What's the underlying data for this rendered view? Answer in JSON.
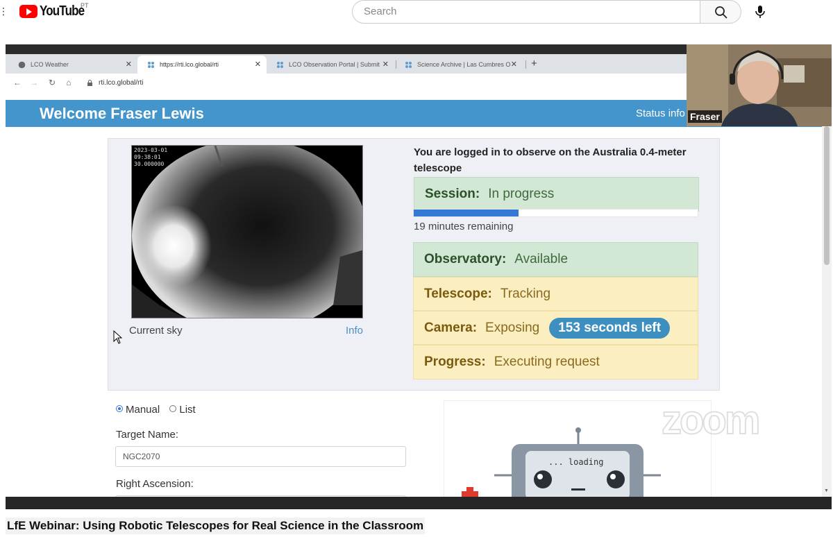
{
  "youtube": {
    "logo_text": "YouTube",
    "country": "PT",
    "search_placeholder": "Search"
  },
  "browser": {
    "tabs": [
      {
        "label": "LCO Weather",
        "active": false
      },
      {
        "label": "https://rti.lco.global/rti",
        "active": true
      },
      {
        "label": "LCO Observation Portal | Submit",
        "active": false
      },
      {
        "label": "Science Archive | Las Cumbres O",
        "active": false
      }
    ],
    "url": "rti.lco.global/rti"
  },
  "page": {
    "welcome": "Welcome Fraser Lewis",
    "status_link": "Status info",
    "sky": {
      "stamp_date": "2023-03-01",
      "stamp_time": "09:38:01",
      "stamp_exp": "30.000000",
      "caption": "Current sky",
      "info_link": "Info"
    },
    "login_text": "You are logged in to observe on the Australia 0.4-meter telescope",
    "session": {
      "label": "Session:",
      "value": "In progress"
    },
    "progress_fraction": 0.37,
    "remaining": "19 minutes remaining",
    "observatory": {
      "label": "Observatory:",
      "value": "Available"
    },
    "telescope": {
      "label": "Telescope:",
      "value": "Tracking"
    },
    "camera": {
      "label": "Camera:",
      "value": "Exposing",
      "badge": "153 seconds left"
    },
    "progress": {
      "label": "Progress:",
      "value": "Executing request"
    },
    "form": {
      "mode_manual": "Manual",
      "mode_list": "List",
      "target_label": "Target Name:",
      "target_value": "NGC2070",
      "ra_label": "Right Ascension:"
    },
    "robot_loading": "... loading"
  },
  "webcam": {
    "name": "Fraser"
  },
  "zoom_watermark": "zoom",
  "video_title": "LfE Webinar: Using Robotic Telescopes for Real Science in the Classroom",
  "colors": {
    "welcome_bar": "#4495cb",
    "status_green": "#d2e7d4",
    "status_yellow": "#fbeec0",
    "badge": "#3d8fc0",
    "progress_bar": "#3378d3"
  }
}
